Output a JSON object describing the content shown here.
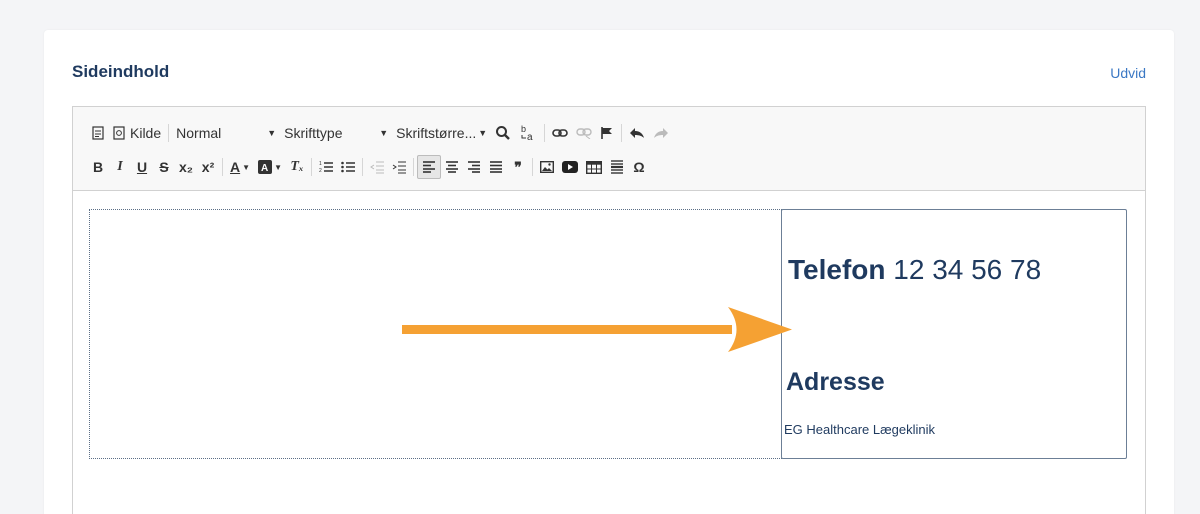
{
  "card": {
    "title": "Sideindhold",
    "expand_label": "Udvid"
  },
  "toolbar": {
    "row1": {
      "source_label": "Kilde",
      "format_value": "Normal",
      "font_value": "Skrifttype",
      "size_value": "Skriftstørre..."
    },
    "row2": {
      "bold": "B",
      "italic": "I",
      "underline": "U",
      "strike": "S",
      "subscript": "x₂",
      "superscript": "x²",
      "text_color": "A",
      "remove_format": "Tₓ",
      "blockquote": "❞",
      "special_char": "Ω"
    }
  },
  "content": {
    "phone_label": "Telefon",
    "phone_number": "12 34 56 78",
    "address_heading": "Adresse",
    "address_text": "EG Healthcare Lægeklinik"
  },
  "colors": {
    "accent_link": "#3b78c4",
    "heading_text": "#1f3a5f",
    "annotation_arrow": "#f5a133"
  }
}
